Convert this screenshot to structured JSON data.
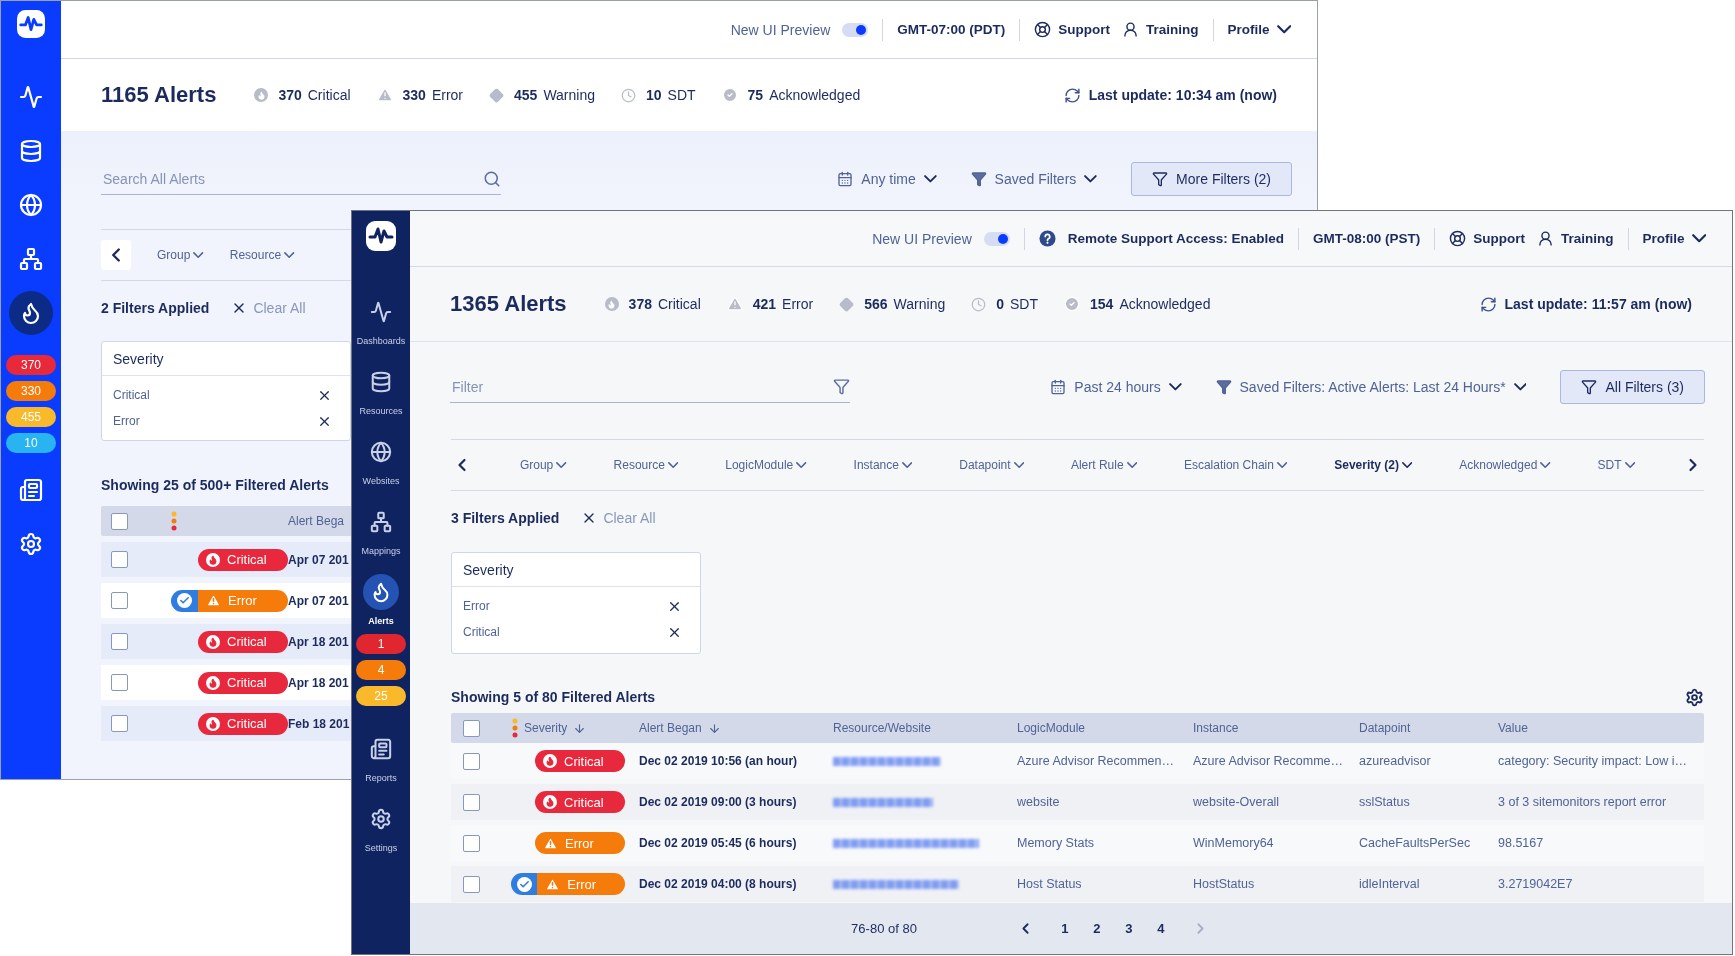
{
  "back_window": {
    "nav_top": [
      {
        "selected": false
      },
      {
        "selected": false
      },
      {
        "selected": false
      },
      {
        "selected": false
      },
      {
        "selected": true
      }
    ],
    "badges": [
      {
        "count": "370",
        "color": "#e8293a"
      },
      {
        "count": "330",
        "color": "#f57c0a"
      },
      {
        "count": "455",
        "color": "#f9b92a"
      },
      {
        "count": "10",
        "color": "#27b4f0"
      }
    ],
    "nav_bottom": [
      {
        "selected": false
      },
      {
        "selected": false
      }
    ],
    "topbar": {
      "preview": "New UI Preview",
      "preview_on": true,
      "timezone": "GMT-07:00 (PDT)",
      "support": "Support",
      "training": "Training",
      "profile": "Profile"
    },
    "summary": {
      "title": "1165 Alerts",
      "stats": [
        {
          "kind": "critical",
          "count": "370",
          "label": "Critical"
        },
        {
          "kind": "error",
          "count": "330",
          "label": "Error"
        },
        {
          "kind": "warning",
          "count": "455",
          "label": "Warning"
        },
        {
          "kind": "sdt",
          "count": "10",
          "label": "SDT"
        },
        {
          "kind": "acknowledged",
          "count": "75",
          "label": "Acknowledged"
        }
      ],
      "last_update": "Last update: 10:34 am (now)"
    },
    "search": {
      "placeholder": "Search All Alerts"
    },
    "time_range": "Any time",
    "saved_filters": "Saved Filters",
    "more_filters": "More Filters (2)",
    "column_filters": [
      {
        "label": "Group",
        "active": false
      },
      {
        "label": "Resource",
        "active": false
      }
    ],
    "filters_applied": "2 Filters Applied",
    "clear_all": "Clear All",
    "severity_filter": {
      "title": "Severity",
      "items": [
        "Critical",
        "Error"
      ]
    },
    "showing": "Showing 25 of 500+ Filtered Alerts",
    "table": {
      "select_all_checked": false,
      "columns": [
        "Alert Bega"
      ],
      "rows": [
        {
          "checked": false,
          "kind": "critical",
          "label": "Critical",
          "acknowledged": false,
          "began": "Apr 07 201"
        },
        {
          "checked": false,
          "kind": "error",
          "label": "Error",
          "acknowledged": true,
          "began": "Apr 07 201"
        },
        {
          "checked": false,
          "kind": "critical",
          "label": "Critical",
          "acknowledged": false,
          "began": "Apr 18 201"
        },
        {
          "checked": false,
          "kind": "critical",
          "label": "Critical",
          "acknowledged": false,
          "began": "Apr 18 201"
        },
        {
          "checked": false,
          "kind": "critical",
          "label": "Critical",
          "acknowledged": false,
          "began": "Feb 18 201"
        }
      ]
    }
  },
  "front_window": {
    "nav_top": [
      {
        "label": "Dashboards",
        "selected": false
      },
      {
        "label": "Resources",
        "selected": false
      },
      {
        "label": "Websites",
        "selected": false
      },
      {
        "label": "Mappings",
        "selected": false
      },
      {
        "label": "Alerts",
        "selected": true
      }
    ],
    "badges": [
      {
        "count": "1",
        "color": "#e0262f"
      },
      {
        "count": "4",
        "color": "#f57c0a"
      },
      {
        "count": "25",
        "color": "#f9b92a"
      }
    ],
    "nav_bottom": [
      {
        "label": "Reports",
        "selected": false
      },
      {
        "label": "Settings",
        "selected": false
      }
    ],
    "topbar": {
      "preview": "New UI Preview",
      "preview_on": true,
      "remote_support": "Remote Support Access: Enabled",
      "timezone": "GMT-08:00 (PST)",
      "support": "Support",
      "training": "Training",
      "profile": "Profile"
    },
    "summary": {
      "title": "1365 Alerts",
      "stats": [
        {
          "kind": "critical",
          "count": "378",
          "label": "Critical"
        },
        {
          "kind": "error",
          "count": "421",
          "label": "Error"
        },
        {
          "kind": "warning",
          "count": "566",
          "label": "Warning"
        },
        {
          "kind": "sdt",
          "count": "0",
          "label": "SDT"
        },
        {
          "kind": "acknowledged",
          "count": "154",
          "label": "Acknowledged"
        }
      ],
      "last_update": "Last update: 11:57 am (now)"
    },
    "search": {
      "placeholder": "Filter"
    },
    "time_range": "Past 24 hours",
    "saved_filters": "Saved Filters: Active Alerts: Last 24 Hours*",
    "more_filters": "All Filters (3)",
    "column_filters": [
      {
        "label": "Group",
        "active": false
      },
      {
        "label": "Resource",
        "active": false
      },
      {
        "label": "LogicModule",
        "active": false
      },
      {
        "label": "Instance",
        "active": false
      },
      {
        "label": "Datapoint",
        "active": false
      },
      {
        "label": "Alert Rule",
        "active": false
      },
      {
        "label": "Escalation Chain",
        "active": false
      },
      {
        "label": "Severity (2)",
        "active": true
      },
      {
        "label": "Acknowledged",
        "active": false
      },
      {
        "label": "SDT",
        "active": false
      }
    ],
    "filters_applied": "3 Filters Applied",
    "clear_all": "Clear All",
    "severity_filter": {
      "title": "Severity",
      "items": [
        "Error",
        "Critical"
      ]
    },
    "showing": "Showing 5 of 80 Filtered Alerts",
    "table": {
      "select_all_checked": false,
      "columns": [
        {
          "label": "Severity",
          "sorted": true
        },
        {
          "label": "Alert Began",
          "sorted": true
        },
        {
          "label": "Resource/Website",
          "sorted": false
        },
        {
          "label": "LogicModule",
          "sorted": false
        },
        {
          "label": "Instance",
          "sorted": false
        },
        {
          "label": "Datapoint",
          "sorted": false
        },
        {
          "label": "Value",
          "sorted": false
        }
      ],
      "rows": [
        {
          "checked": false,
          "kind": "critical",
          "label": "Critical",
          "acknowledged": false,
          "began": "Dec 02 2019 10:56 (an hour)",
          "logic_module": "Azure Advisor Recommen…",
          "instance": "Azure Advisor Recomme…",
          "datapoint": "azureadvisor",
          "value": "category: Security impact: Low i…"
        },
        {
          "checked": false,
          "kind": "critical",
          "label": "Critical",
          "acknowledged": false,
          "began": "Dec 02 2019 09:00 (3 hours)",
          "logic_module": "website",
          "instance": "website-Overall",
          "datapoint": "sslStatus",
          "value": "3 of 3 sitemonitors report error"
        },
        {
          "checked": false,
          "kind": "error",
          "label": "Error",
          "acknowledged": false,
          "began": "Dec 02 2019 05:45 (6 hours)",
          "logic_module": "Memory Stats",
          "instance": "WinMemory64",
          "datapoint": "CacheFaultsPerSec",
          "value": "98.5167"
        },
        {
          "checked": false,
          "kind": "error",
          "label": "Error",
          "acknowledged": true,
          "began": "Dec 02 2019 04:00 (8 hours)",
          "logic_module": "Host Status",
          "instance": "HostStatus",
          "datapoint": "idleInterval",
          "value": "3.2719042E7"
        }
      ]
    },
    "pagination": {
      "range": "76-80 of 80",
      "pages": [
        {
          "label": "1",
          "selected": false
        },
        {
          "label": "2",
          "selected": false
        },
        {
          "label": "3",
          "selected": false
        },
        {
          "label": "4",
          "selected": false
        }
      ]
    }
  }
}
